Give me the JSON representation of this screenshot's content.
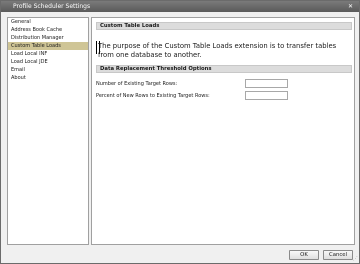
{
  "window": {
    "title": "Profile Scheduler Settings",
    "close_glyph": "✕"
  },
  "sidebar": {
    "items": [
      {
        "label": "General"
      },
      {
        "label": "Address Book Cache"
      },
      {
        "label": "Distribution Manager"
      },
      {
        "label": "Custom Table Loads",
        "selected": true
      },
      {
        "label": "Load Local INF"
      },
      {
        "label": "Load Local JDE"
      },
      {
        "label": "Email"
      },
      {
        "label": "About"
      }
    ]
  },
  "main": {
    "section_title": "Custom Table Loads",
    "description": "The purpose of the Custom Table Loads extension is to transfer tables from one database to another.",
    "threshold_title": "Data Replacement Threshold Options",
    "rows": [
      {
        "label": "Number of Existing Target Rows:",
        "value": ""
      },
      {
        "label": "Percent of New Rows to Existing Target Rows:",
        "value": ""
      }
    ]
  },
  "footer": {
    "ok_label": "OK",
    "cancel_label": "Cancel"
  }
}
